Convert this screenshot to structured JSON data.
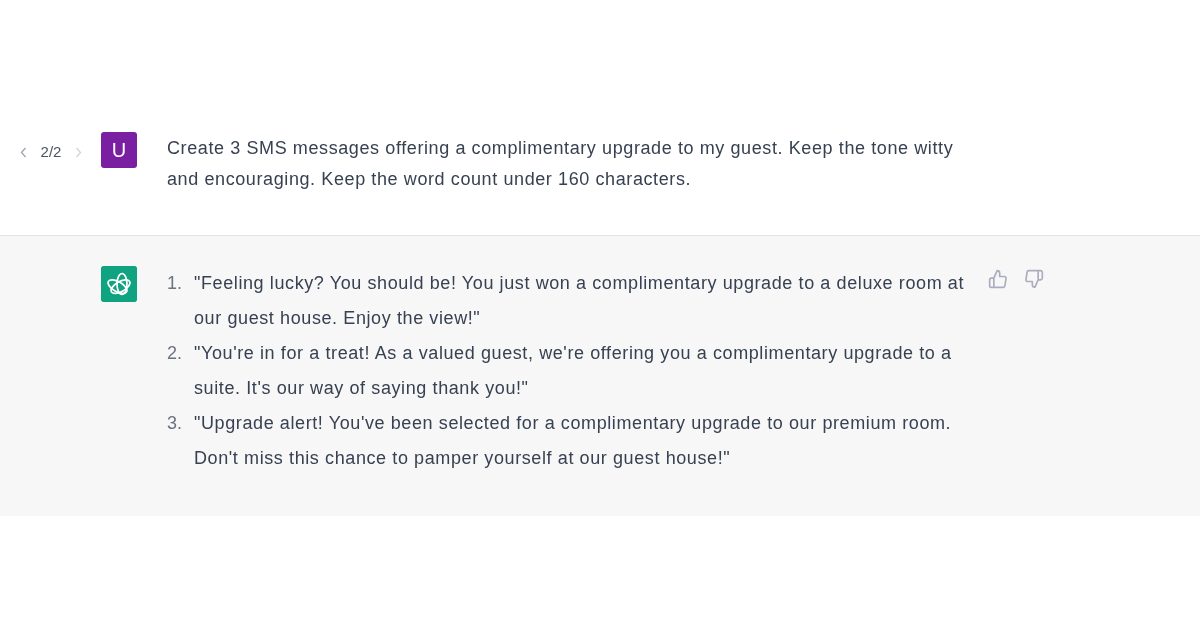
{
  "user_message": {
    "pager": "2/2",
    "avatar_letter": "U",
    "text": "Create 3 SMS messages offering a complimentary upgrade to my guest. Keep the tone witty and encouraging. Keep the word count under 160 characters."
  },
  "assistant_message": {
    "items": [
      {
        "number": "1.",
        "text": "\"Feeling lucky? You should be! You just won a complimentary upgrade to a deluxe room at our guest house. Enjoy the view!\""
      },
      {
        "number": "2.",
        "text": "\"You're in for a treat! As a valued guest, we're offering you a complimentary upgrade to a suite. It's our way of saying thank you!\""
      },
      {
        "number": "3.",
        "text": "\"Upgrade alert! You've been selected for a complimentary upgrade to our premium room. Don't miss this chance to pamper yourself at our guest house!\""
      }
    ]
  }
}
